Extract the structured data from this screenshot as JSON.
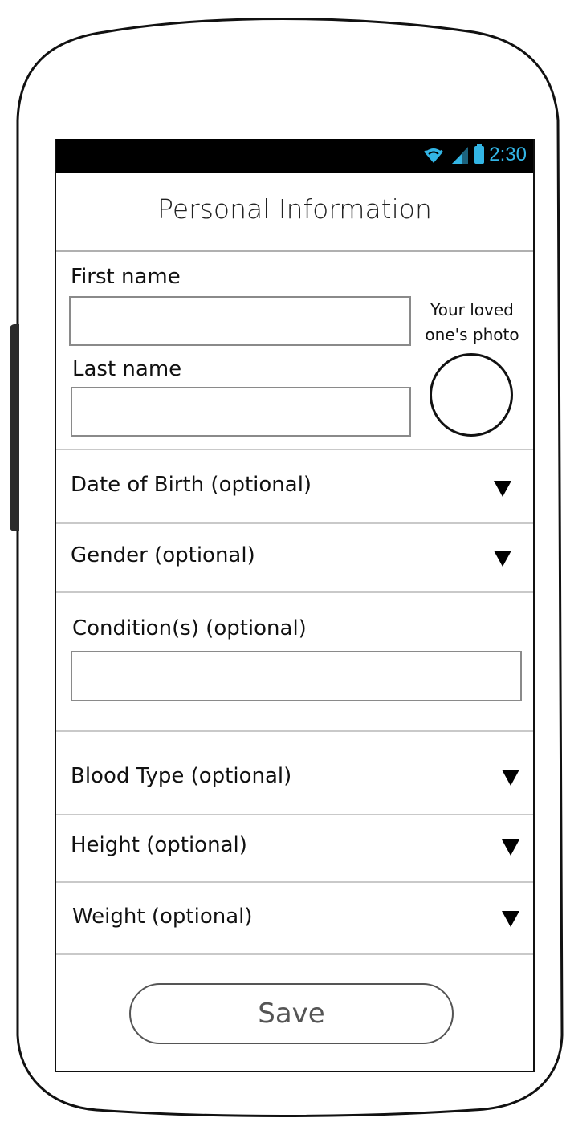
{
  "status_bar": {
    "time": "2:30",
    "icons": [
      "wifi-icon",
      "signal-icon",
      "battery-icon"
    ],
    "accent_color": "#33b5e5"
  },
  "header": {
    "title": "Personal Information"
  },
  "form": {
    "first_name": {
      "label": "First name",
      "value": ""
    },
    "last_name": {
      "label": "Last name",
      "value": ""
    },
    "photo": {
      "caption_line1": "Your loved",
      "caption_line2": "one's photo"
    },
    "date_of_birth": {
      "label": "Date of Birth (optional)"
    },
    "gender": {
      "label": "Gender (optional)"
    },
    "conditions": {
      "label": "Condition(s) (optional)",
      "value": ""
    },
    "blood_type": {
      "label": "Blood Type (optional)"
    },
    "height": {
      "label": "Height (optional)"
    },
    "weight": {
      "label": "Weight (optional)"
    }
  },
  "actions": {
    "save_label": "Save"
  }
}
